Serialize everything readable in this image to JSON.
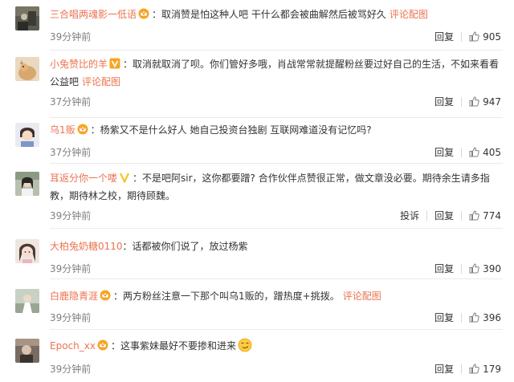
{
  "comments": [
    {
      "username": "三合唱两魂影一低语",
      "badge": "crown-badge",
      "text": "：取消赞是怕这种人吧 干什么都会被曲解然后被骂好久",
      "link": "评论配图",
      "time": "39分钟前",
      "actions": [
        "回复"
      ],
      "likes": "905"
    },
    {
      "username": "小兔赞比的羊",
      "badge": "v-badge",
      "text": "：取消就取消了呗。你们管好多哦，肖战常常就提醒粉丝要过好自己的生活，不如来看看公益吧",
      "link": "评论配图",
      "time": "37分钟前",
      "actions": [
        "回复"
      ],
      "likes": "947"
    },
    {
      "username": "乌1贩",
      "badge": "crown-badge",
      "text": "：杨紫又不是什么好人 她自己投资台独剧 互联网难道没有记忆吗?",
      "link": "",
      "time": "37分钟前",
      "actions": [
        "回复"
      ],
      "likes": "405"
    },
    {
      "username": "耳返分你一个喽",
      "badge": "v-badge-yellow",
      "text": "：不是吧阿sir，这你都要蹭? 合作伙伴点赞很正常，做文章没必要。期待余生请多指教，期待林之校，期待顾魏。",
      "link": "",
      "time": "39分钟前",
      "actions": [
        "投诉",
        "回复"
      ],
      "likes": "774"
    },
    {
      "username": "大柏兔奶糖0110",
      "badge": "",
      "text": "：话都被你们说了，放过杨紫",
      "link": "",
      "time": "39分钟前",
      "actions": [
        "回复"
      ],
      "likes": "390"
    },
    {
      "username": "白鹿隐青涯",
      "badge": "crown-badge",
      "text": "：两方粉丝注意一下那个叫乌1贩的，蹭热度+挑拨。",
      "link": "评论配图",
      "time": "39分钟前",
      "actions": [
        "回复"
      ],
      "likes": "396"
    },
    {
      "username": "Epoch_xx",
      "badge": "crown-badge",
      "text": "：这事紫妹最好不要掺和进来",
      "emoji": "smirk-emoji",
      "link": "",
      "time": "39分钟前",
      "actions": [
        "回复"
      ],
      "likes": "179"
    }
  ],
  "colors": {
    "username": "#eb7350",
    "meta": "#808080",
    "text": "#333333",
    "divider": "#ebebeb"
  }
}
